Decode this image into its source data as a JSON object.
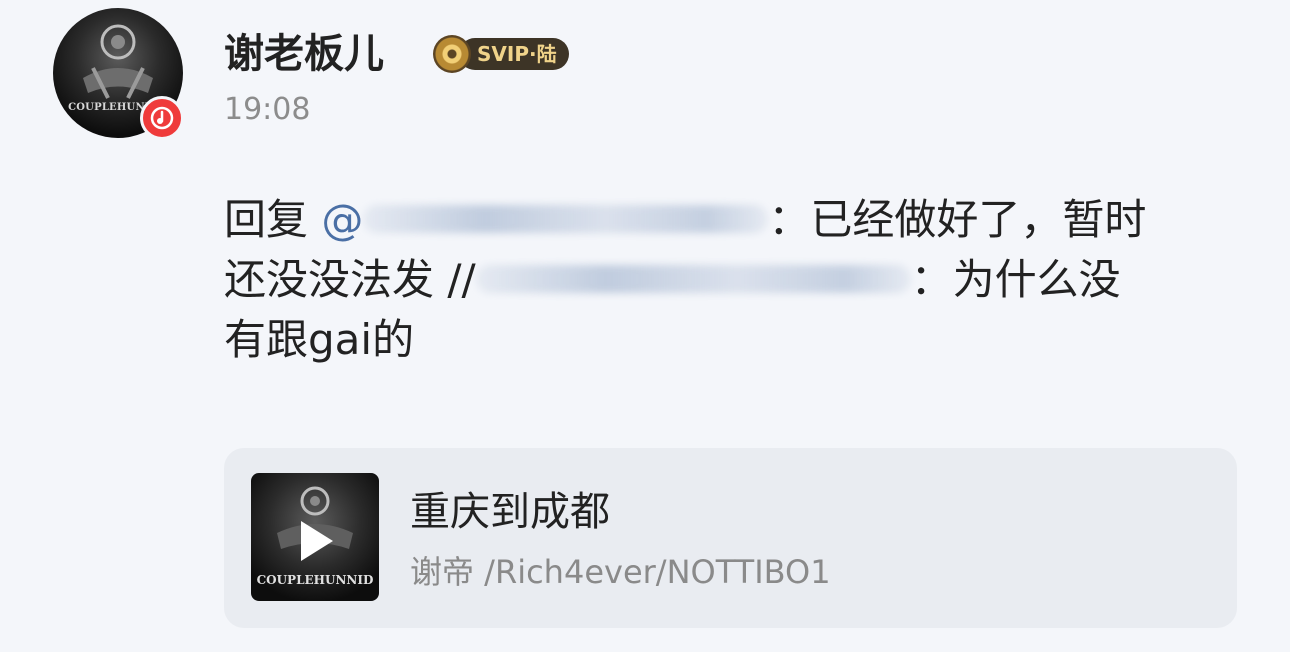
{
  "post": {
    "username": "谢老板儿",
    "vip_label": "SVIP·陆",
    "timestamp": "19:08",
    "reply_prefix": "回复 ",
    "mention_at": "@",
    "reply_text": "：已经做好了，暂时",
    "line2_text": "还没没法发 //",
    "line2_tail": "：为什么没",
    "line3_text": "有跟gai的"
  },
  "avatar": {
    "cover_text": "COUPLEHUNNID"
  },
  "music_card": {
    "title": "重庆到成都",
    "artist": "谢帝 /Rich4ever/NOTTIBO1",
    "cover_text": "COUPLEHUNNID"
  },
  "colors": {
    "background": "#f4f6fa",
    "mention": "#4a6fa5",
    "music_badge": "#ef3b3b",
    "vip_gold": "#f0d38a",
    "card_bg": "#e9ecf1"
  }
}
